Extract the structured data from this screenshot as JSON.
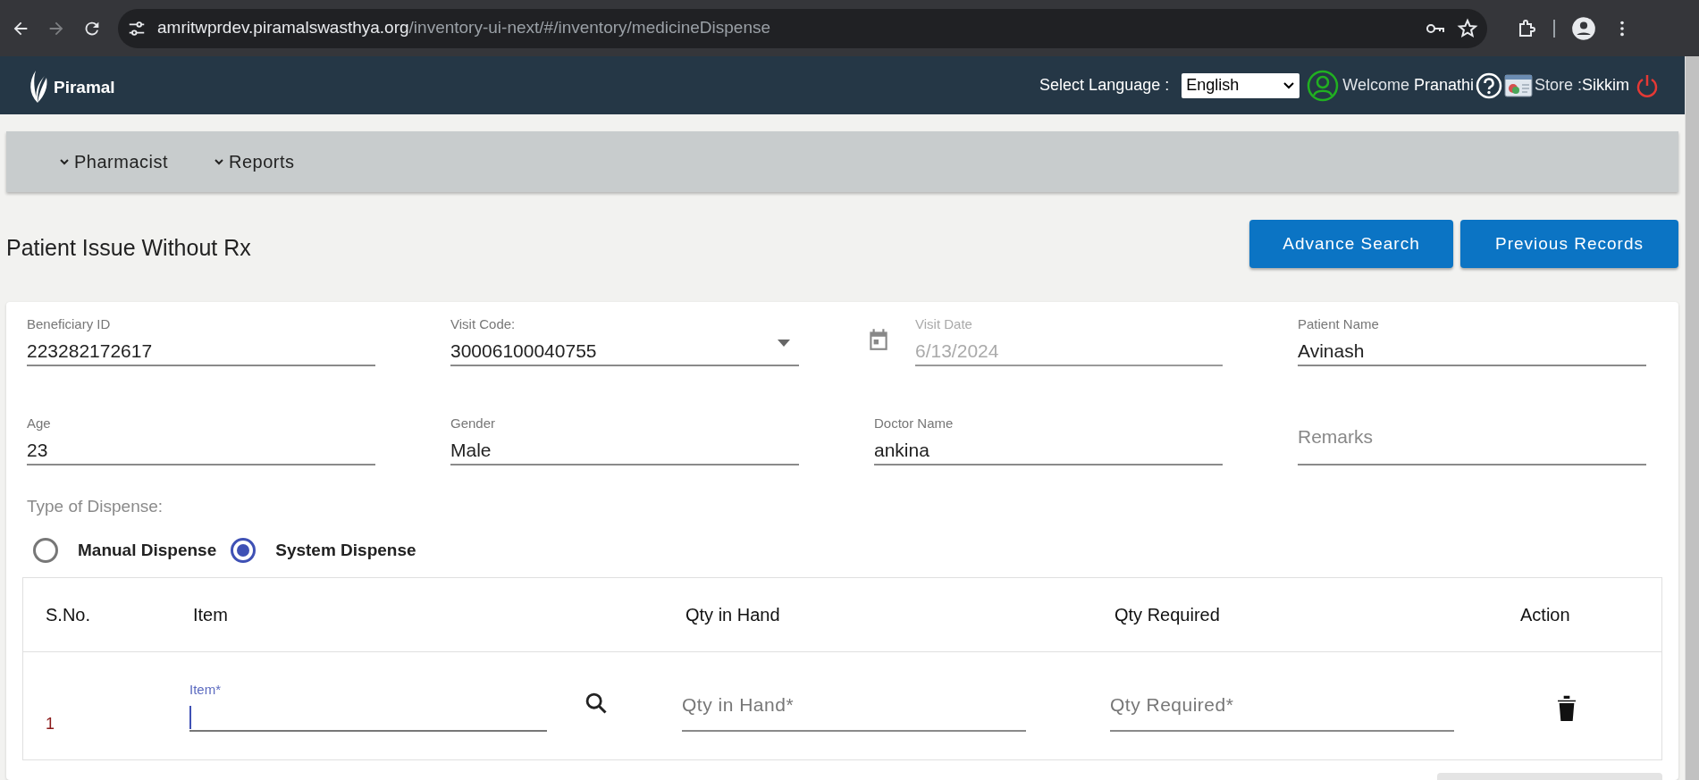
{
  "browser": {
    "url_domain": "amritwprdev.piramalswasthya.org",
    "url_path": "/inventory-ui-next/#/inventory/medicineDispense"
  },
  "header": {
    "logo_text": "Piramal",
    "language_label": "Select Language :",
    "language": "English",
    "welcome": "Welcome",
    "user": "Pranathi",
    "store_label": "Store :",
    "store": "Sikkim"
  },
  "nav": [
    {
      "label": "Pharmacist"
    },
    {
      "label": "Reports"
    }
  ],
  "page_title": "Patient Issue Without Rx",
  "actions": [
    "Advance Search",
    "Previous Records"
  ],
  "fields": [
    {
      "kind": "text",
      "label": "Beneficiary ID",
      "value": "223282172617",
      "disabled": false
    },
    {
      "kind": "select",
      "label": "Visit Code:",
      "value": "30006100040755",
      "disabled": false
    },
    {
      "kind": "date",
      "label": "Visit Date",
      "value": "6/13/2024",
      "disabled": true
    },
    {
      "kind": "text",
      "label": "Patient Name",
      "value": "Avinash",
      "disabled": false
    },
    {
      "kind": "text",
      "label": "Age",
      "value": "23",
      "disabled": false
    },
    {
      "kind": "text",
      "label": "Gender",
      "value": "Male",
      "disabled": false
    },
    {
      "kind": "text",
      "label": "Doctor Name",
      "value": "ankina",
      "disabled": false
    },
    {
      "kind": "text",
      "placeholder": "Remarks",
      "disabled": false
    }
  ],
  "dispense": {
    "label": "Type of Dispense:",
    "options": [
      {
        "label": "Manual Dispense",
        "selected": false
      },
      {
        "label": "System Dispense",
        "selected": true
      }
    ]
  },
  "table": {
    "columns": [
      "S.No.",
      "Item",
      "Qty in Hand",
      "Qty Required",
      "Action"
    ],
    "rows": [
      {
        "sno": "1",
        "item": {
          "label": "Item*",
          "focused": true
        },
        "qty_in_hand": {
          "placeholder": "Qty in Hand*"
        },
        "qty_required": {
          "placeholder": "Qty Required*"
        }
      }
    ]
  }
}
